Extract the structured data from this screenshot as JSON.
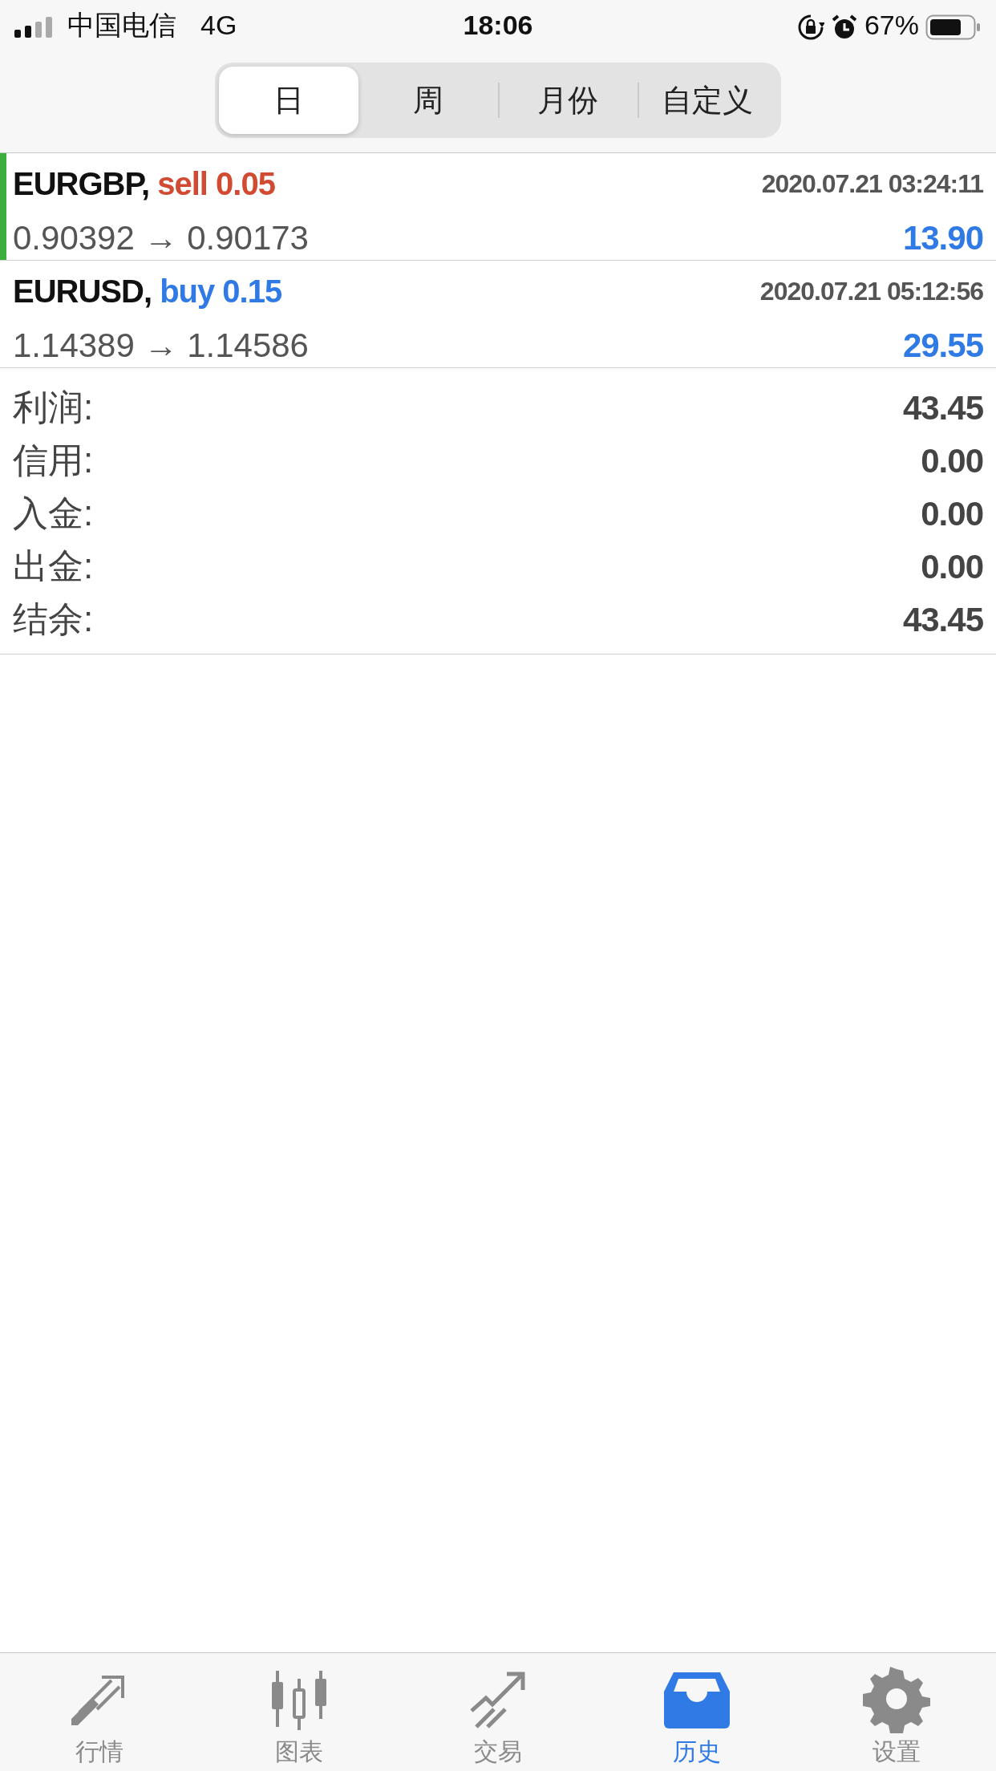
{
  "status_bar": {
    "carrier": "中国电信",
    "network": "4G",
    "time": "18:06",
    "battery": "67%"
  },
  "periods": [
    {
      "label": "日",
      "selected": true
    },
    {
      "label": "周",
      "selected": false
    },
    {
      "label": "月份",
      "selected": false
    },
    {
      "label": "自定义",
      "selected": false
    }
  ],
  "trades": [
    {
      "symbol": "EURGBP,",
      "side": "sell",
      "volume": "0.05",
      "time": "2020.07.21 03:24:11",
      "prices": "0.90392 → 0.90173",
      "profit": "13.90",
      "selected": true
    },
    {
      "symbol": "EURUSD,",
      "side": "buy",
      "volume": "0.15",
      "time": "2020.07.21 05:12:56",
      "prices": "1.14389 → 1.14586",
      "profit": "29.55",
      "selected": false
    }
  ],
  "summary": [
    {
      "label": "利润:",
      "value": "43.45"
    },
    {
      "label": "信用:",
      "value": "0.00"
    },
    {
      "label": "入金:",
      "value": "0.00"
    },
    {
      "label": "出金:",
      "value": "0.00"
    },
    {
      "label": "结余:",
      "value": "43.45"
    }
  ],
  "tab_bar": [
    {
      "label": "行情",
      "kind": "quotes",
      "selected": false
    },
    {
      "label": "图表",
      "kind": "chart",
      "selected": false
    },
    {
      "label": "交易",
      "kind": "trade",
      "selected": false
    },
    {
      "label": "历史",
      "kind": "history",
      "selected": true
    },
    {
      "label": "设置",
      "kind": "settings",
      "selected": false
    }
  ]
}
